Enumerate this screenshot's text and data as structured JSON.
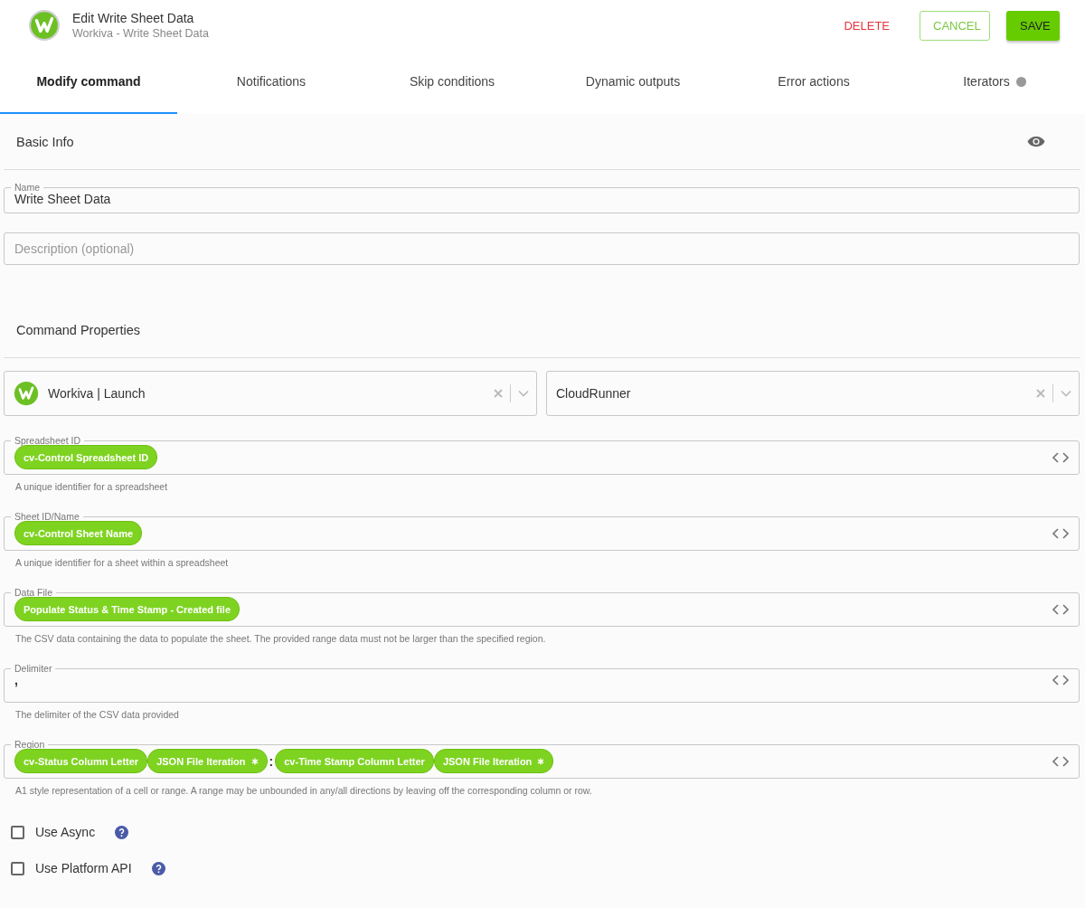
{
  "header": {
    "title": "Edit Write Sheet Data",
    "subtitle": "Workiva - Write Sheet Data",
    "actions": [
      {
        "label": "DELETE",
        "kind": "danger"
      },
      {
        "label": "CANCEL",
        "kind": "outline"
      },
      {
        "label": "SAVE",
        "kind": "primary"
      }
    ]
  },
  "tabs": [
    {
      "label": "Modify command",
      "selected": true,
      "indicator": false
    },
    {
      "label": "Notifications",
      "selected": false,
      "indicator": false
    },
    {
      "label": "Skip conditions",
      "selected": false,
      "indicator": false
    },
    {
      "label": "Dynamic outputs",
      "selected": false,
      "indicator": false
    },
    {
      "label": "Error actions",
      "selected": false,
      "indicator": false
    },
    {
      "label": "Iterators",
      "selected": false,
      "indicator": true
    }
  ],
  "basic_info": {
    "title": "Basic Info",
    "name": {
      "label": "Name",
      "value": "Write Sheet Data"
    },
    "description": {
      "placeholder": "Description (optional)"
    }
  },
  "command_properties": {
    "title": "Command Properties",
    "selects": [
      {
        "value": "Workiva | Launch",
        "logo": true
      },
      {
        "value": "CloudRunner",
        "logo": false
      }
    ],
    "fields": [
      {
        "label": "Spreadsheet ID",
        "parts": [
          {
            "kind": "token",
            "text": "cv-Control Spreadsheet ID",
            "starred": false
          }
        ],
        "hint": "A unique identifier for a spreadsheet"
      },
      {
        "label": "Sheet ID/Name",
        "parts": [
          {
            "kind": "token",
            "text": "cv-Control Sheet Name",
            "starred": false
          }
        ],
        "hint": "A unique identifier for a sheet within a spreadsheet"
      },
      {
        "label": "Data File",
        "parts": [
          {
            "kind": "token",
            "text": "Populate Status & Time Stamp - Created file",
            "starred": false
          }
        ],
        "hint": "The CSV data containing the data to populate the sheet. The provided range data must not be larger than the specified region."
      },
      {
        "label": "Delimiter",
        "parts": [
          {
            "kind": "text",
            "text": ","
          }
        ],
        "hint": "The delimiter of the CSV data provided"
      },
      {
        "label": "Region",
        "parts": [
          {
            "kind": "token",
            "text": "cv-Status Column Letter",
            "starred": false
          },
          {
            "kind": "token",
            "text": "JSON File Iteration",
            "starred": true
          },
          {
            "kind": "text",
            "text": ":"
          },
          {
            "kind": "token",
            "text": "cv-Time Stamp Column Letter",
            "starred": false
          },
          {
            "kind": "token",
            "text": "JSON File Iteration",
            "starred": true
          }
        ],
        "hint": "A1 style representation of a cell or range. A range may be unbounded in any/all directions by leaving off the corresponding column or row."
      }
    ],
    "options": [
      {
        "label": "Use Async",
        "checked": false
      },
      {
        "label": "Use Platform API",
        "checked": false
      }
    ]
  }
}
